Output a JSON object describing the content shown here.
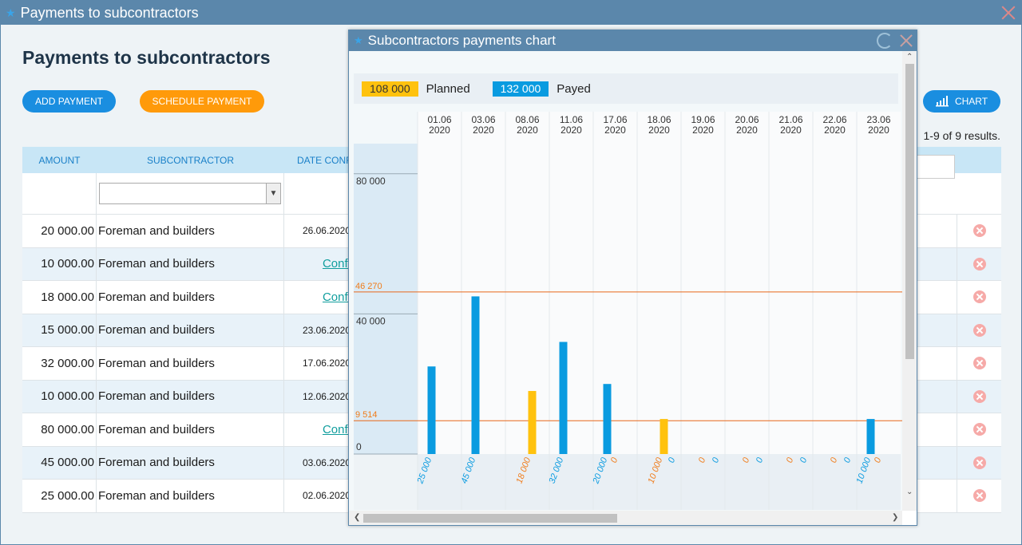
{
  "window": {
    "title": "Payments to subcontractors"
  },
  "page": {
    "title": "Payments to subcontractors",
    "add_label": "ADD PAYMENT",
    "schedule_label": "SCHEDULE PAYMENT",
    "chart_label": "CHART",
    "results": "1-9 of 9 results."
  },
  "table": {
    "headers": [
      "AMOUNT",
      "SUBCONTRACTOR",
      "DATE CONF"
    ],
    "rows": [
      {
        "amount": "20 000.00",
        "subcontractor": "Foreman and builders",
        "date": "26.06.2020",
        "link": false
      },
      {
        "amount": "10 000.00",
        "subcontractor": "Foreman and builders",
        "date": "Confi",
        "link": true
      },
      {
        "amount": "18 000.00",
        "subcontractor": "Foreman and builders",
        "date": "Confi",
        "link": true
      },
      {
        "amount": "15 000.00",
        "subcontractor": "Foreman and builders",
        "date": "23.06.2020",
        "link": false
      },
      {
        "amount": "32 000.00",
        "subcontractor": "Foreman and builders",
        "date": "17.06.2020",
        "link": false
      },
      {
        "amount": "10 000.00",
        "subcontractor": "Foreman and builders",
        "date": "12.06.2020",
        "link": false
      },
      {
        "amount": "80 000.00",
        "subcontractor": "Foreman and builders",
        "date": "Confi",
        "link": true
      },
      {
        "amount": "45 000.00",
        "subcontractor": "Foreman and builders",
        "date": "03.06.2020",
        "link": false
      },
      {
        "amount": "25 000.00",
        "subcontractor": "Foreman and builders",
        "date": "02.06.2020",
        "link": false
      }
    ]
  },
  "dialog": {
    "title": "Subcontractors payments chart",
    "legend": [
      {
        "value": "108 000",
        "label": "Planned",
        "color": "#ffc20e"
      },
      {
        "value": "132 000",
        "label": "Payed",
        "color": "#0a9be0"
      }
    ]
  },
  "colors": {
    "planned": "#ffc20e",
    "payed": "#0a9be0",
    "line": "#e8681a",
    "label_planned": "#f07c1a",
    "label_payed": "#0a9be0"
  },
  "chart_data": {
    "type": "bar",
    "categories": [
      "01.06\n2020",
      "03.06\n2020",
      "08.06\n2020",
      "11.06\n2020",
      "17.06\n2020",
      "18.06\n2020",
      "19.06\n2020",
      "20.06\n2020",
      "21.06\n2020",
      "22.06\n2020",
      "23.06\n2020"
    ],
    "series": [
      {
        "name": "Planned",
        "values": [
          0,
          0,
          18000,
          0,
          0,
          10000,
          0,
          0,
          0,
          0,
          0
        ]
      },
      {
        "name": "Payed",
        "values": [
          25000,
          45000,
          0,
          32000,
          20000,
          0,
          0,
          0,
          0,
          0,
          10000
        ]
      }
    ],
    "bar_labels": [
      {
        "planned": "",
        "payed": "25 000"
      },
      {
        "planned": "",
        "payed": "45 000"
      },
      {
        "planned": "18 000",
        "payed": ""
      },
      {
        "planned": "",
        "payed": "32 000"
      },
      {
        "planned": "0",
        "payed": "20 000"
      },
      {
        "planned": "10 000",
        "payed": "0"
      },
      {
        "planned": "0",
        "payed": "0"
      },
      {
        "planned": "0",
        "payed": "0"
      },
      {
        "planned": "0",
        "payed": "0"
      },
      {
        "planned": "0",
        "payed": "0"
      },
      {
        "planned": "0",
        "payed": "10 000"
      }
    ],
    "y_ticks": [
      0,
      40000,
      80000
    ],
    "y_tick_labels": [
      "0",
      "40 000",
      "80 000"
    ],
    "reference_lines": [
      {
        "value": 46270,
        "label": "46 270"
      },
      {
        "value": 9514,
        "label": "9 514"
      }
    ],
    "ylim": [
      0,
      88600
    ]
  }
}
